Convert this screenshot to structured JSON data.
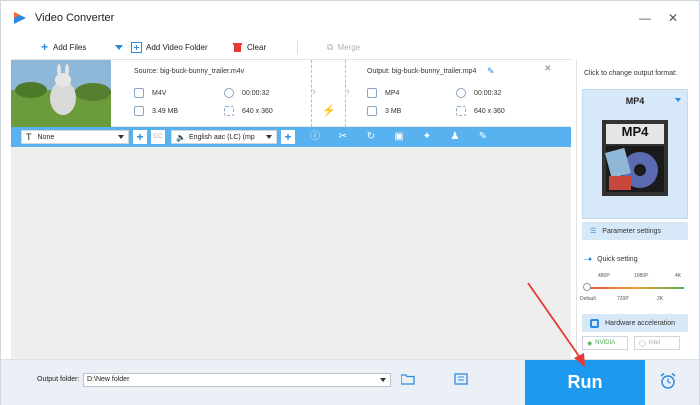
{
  "window": {
    "title": "Video Converter",
    "min_icon": "minimize-icon",
    "close_icon": "close-icon"
  },
  "toolbar": {
    "add_files": "Add Files",
    "add_video_folder": "Add Video Folder",
    "clear": "Clear",
    "merge": "Merge"
  },
  "file": {
    "source_label": "Source: big-buck-bunny_trailer.m4v",
    "source_format": "M4V",
    "source_duration": "00:00:32",
    "source_size": "3.49 MB",
    "source_resolution": "640 x 360",
    "output_label": "Output: big-buck-bunny_trailer.mp4",
    "output_format": "MP4",
    "output_duration": "00:00:32",
    "output_size": "3 MB",
    "output_resolution": "640 x 360"
  },
  "edit_bar": {
    "subtitle_value": "None",
    "audio_value": "English aac (LC) (mp"
  },
  "right_panel": {
    "hint": "Click to change output format:",
    "format": "MP4",
    "format_icon_text": "MP4",
    "parameter_settings": "Parameter settings",
    "quick_setting": "Quick setting",
    "ticks_top": [
      "480P",
      "1080P",
      "4K"
    ],
    "ticks_bottom": [
      "Default",
      "720P",
      "2K"
    ],
    "quality_level": 0,
    "hardware_acceleration": "Hardware acceleration",
    "chip_nvidia": "NVIDIA",
    "chip_intel": "Intel"
  },
  "bottom": {
    "output_folder_label": "Output folder:",
    "output_folder_value": "D:\\New folder",
    "run": "Run"
  },
  "colors": {
    "accent": "#1d99ef",
    "edit_bar": "#58b2f0",
    "panel": "#d7e8f8",
    "annotation": "#e53935"
  }
}
